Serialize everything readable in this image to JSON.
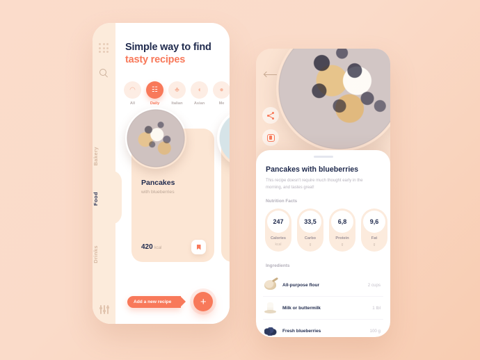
{
  "theme": {
    "background_start": "#FBDCCB",
    "background_end": "#F8CCB1",
    "accent": "#F8795A",
    "text_dark": "#1F2A4D",
    "panel_cream": "#FCEBDB",
    "card_cream": "#FCE6D4"
  },
  "left_screen": {
    "grid_icon": "grid-dots-icon",
    "search_icon": "search-icon",
    "filter_icon": "filter-sliders-icon",
    "nav_items": [
      {
        "label": "Bakery",
        "active": false
      },
      {
        "label": "Food",
        "active": true
      },
      {
        "label": "Drinks",
        "active": false
      }
    ],
    "headline_line1": "Simple way to find",
    "headline_line2": "tasty recipes",
    "categories": [
      {
        "label": "All",
        "glyph": "◠",
        "active": false
      },
      {
        "label": "Daily",
        "glyph": "☷",
        "active": true
      },
      {
        "label": "Italian",
        "glyph": "♣",
        "active": false
      },
      {
        "label": "Asian",
        "glyph": "◖",
        "active": false
      },
      {
        "label": "Me",
        "glyph": "●",
        "active": false
      }
    ],
    "cards": [
      {
        "title": "Pancakes",
        "subtitle": "with blueberries",
        "calories": "420",
        "calories_unit": "kcal",
        "bookmark_icon": "bookmark-icon"
      },
      {
        "title": "",
        "subtitle": "",
        "calories": "",
        "calories_unit": "",
        "bookmark_icon": "bookmark-icon"
      }
    ],
    "cta_label": "Add a new recipe",
    "fab_label": "+"
  },
  "right_screen": {
    "back_icon": "back-arrow-icon",
    "share_icon": "share-icon",
    "save_icon": "save-bookmark-icon",
    "drag_handle": "drag-handle",
    "title": "Pancakes with blueberries",
    "description": "This recipe doesn't require much thought early in the morning, and tastes great!",
    "nutrition_label": "Nutrition Facts",
    "nutrition": [
      {
        "value": "247",
        "name": "Calories",
        "unit": "kcal"
      },
      {
        "value": "33,5",
        "name": "Carbo",
        "unit": "g"
      },
      {
        "value": "6,8",
        "name": "Protein",
        "unit": "g"
      },
      {
        "value": "9,6",
        "name": "Fat",
        "unit": "g"
      }
    ],
    "ingredients_label": "Ingredients",
    "ingredients": [
      {
        "name": "All-purpose flour",
        "qty": "2 cups",
        "icon": "flour-icon"
      },
      {
        "name": "Milk or buttermilk",
        "qty": "1 tbl",
        "icon": "milk-bottle-icon"
      },
      {
        "name": "Fresh blueberries",
        "qty": "100 g",
        "icon": "blueberries-icon"
      }
    ]
  }
}
